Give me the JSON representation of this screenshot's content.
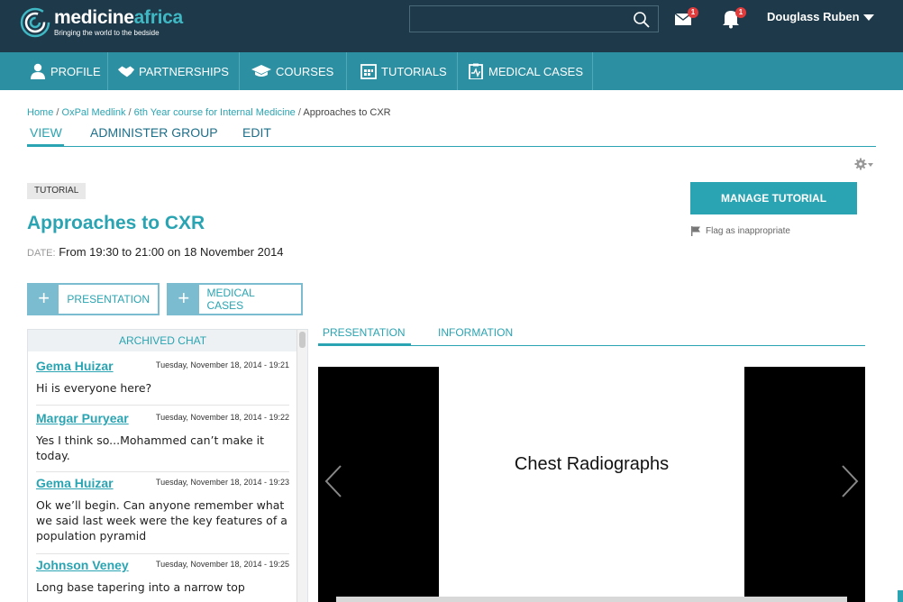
{
  "brand": {
    "name_part1": "medicine",
    "name_part2": "africa",
    "tagline": "Bringing the world to the bedside"
  },
  "header": {
    "search_placeholder": "",
    "mail_badge": "1",
    "bell_badge": "1",
    "user_name": "Douglass Ruben"
  },
  "nav": {
    "items": [
      {
        "label": "PROFILE",
        "icon": "person-icon"
      },
      {
        "label": "PARTNERSHIPS",
        "icon": "handshake-icon"
      },
      {
        "label": "COURSES",
        "icon": "graduation-cap-icon"
      },
      {
        "label": "TUTORIALS",
        "icon": "calendar-icon"
      },
      {
        "label": "MEDICAL CASES",
        "icon": "clipboard-icon"
      }
    ]
  },
  "breadcrumb": {
    "items": [
      "Home",
      "OxPal Medlink",
      "6th Year course for Internal Medicine"
    ],
    "current": "Approaches to CXR",
    "separator": "/"
  },
  "tabs": {
    "view": "VIEW",
    "administer": "ADMINISTER GROUP",
    "edit": "EDIT"
  },
  "page": {
    "type_badge": "TUTORIAL",
    "title": "Approaches to CXR",
    "date_label": "DATE:",
    "date_value": "From 19:30 to 21:00 on 18 November 2014",
    "manage_button": "MANAGE TUTORIAL",
    "flag_label": "Flag as inappropriate",
    "add_presentation": "PRESENTATION",
    "add_cases": "MEDICAL CASES"
  },
  "chat": {
    "heading": "ARCHIVED CHAT",
    "messages": [
      {
        "name": "Gema Huizar",
        "time": "Tuesday, November 18, 2014 - 19:21",
        "text": "Hi is everyone here?"
      },
      {
        "name": "Margar Puryear",
        "time": "Tuesday, November 18, 2014 - 19:22",
        "text": "Yes I think so...Mohammed can’t make it today."
      },
      {
        "name": "Gema Huizar",
        "time": "Tuesday, November 18, 2014 - 19:23",
        "text": "Ok we’ll begin. Can anyone remember what we said last week were the key features of a population pyramid"
      },
      {
        "name": "Johnson Veney",
        "time": "Tuesday, November 18, 2014 - 19:25",
        "text": "Long base tapering into a narrow top"
      }
    ]
  },
  "presentation": {
    "tab_presentation": "PRESENTATION",
    "tab_information": "INFORMATION",
    "slide_title": "Chest Radiographs"
  },
  "colors": {
    "topbar": "#1e3a4a",
    "navbar": "#2c8fa2",
    "accent": "#2aa4b2",
    "badge": "#e23b3b"
  }
}
